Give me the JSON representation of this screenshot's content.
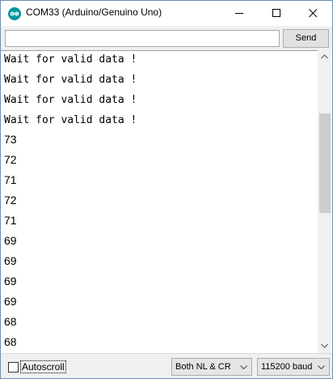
{
  "window": {
    "title": "COM33 (Arduino/Genuino Uno)",
    "accent": "#00979c"
  },
  "icons": {
    "app": "arduino-logo-icon",
    "minimize": "minimize-icon",
    "maximize": "maximize-icon",
    "close": "close-icon",
    "scroll_up": "chevron-up-icon",
    "scroll_down": "chevron-down-icon",
    "dropdown": "chevron-down-icon"
  },
  "send_bar": {
    "input_value": "",
    "send_label": "Send"
  },
  "output": {
    "lines": [
      "Wait for valid data !",
      "Wait for valid data !",
      "Wait for valid data !",
      "Wait for valid data !",
      "73",
      "72",
      "71",
      "72",
      "71",
      "69",
      "69",
      "69",
      "69",
      "68",
      "68"
    ]
  },
  "footer": {
    "autoscroll_label": "Autoscroll",
    "autoscroll_checked": false,
    "line_ending": "Both NL & CR",
    "baud_rate": "115200 baud"
  }
}
